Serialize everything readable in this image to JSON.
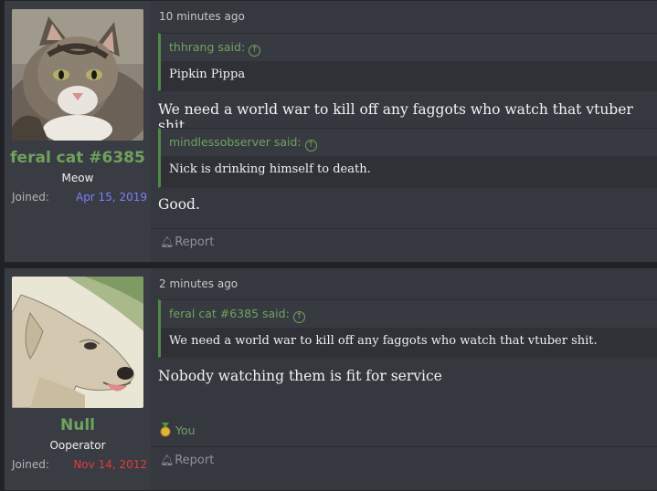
{
  "posts": [
    {
      "username": "feral cat #6385",
      "user_title": "Meow",
      "joined_label": "Joined:",
      "joined_date": "Apr 15, 2019",
      "joined_color": "#7b7fff",
      "avatar_icon": "cat-avatar",
      "timestamp": "10 minutes ago",
      "quotes": [
        {
          "author": "thhrang said:",
          "text": "Pipkin Pippa"
        },
        {
          "author": "mindlessobserver said:",
          "text": "Nick is drinking himself to death."
        }
      ],
      "messages": [
        "We need a world war to kill off any faggots who watch that vtuber shit.",
        "Good."
      ],
      "report_label": "Report"
    },
    {
      "username": "Null",
      "user_title": "Ooperator",
      "joined_label": "Joined:",
      "joined_date": "Nov 14, 2012",
      "joined_color": "#e03c3c",
      "avatar_icon": "dog-avatar",
      "timestamp": "2 minutes ago",
      "quotes": [
        {
          "author": "feral cat #6385 said:",
          "text": "We need a world war to kill off any faggots who watch that vtuber shit."
        }
      ],
      "messages": [
        "Nobody watching them is fit for service"
      ],
      "reaction_label": "You",
      "report_label": "Report"
    }
  ],
  "colors": {
    "accent": "#6fa35d",
    "background": "#36383f"
  }
}
